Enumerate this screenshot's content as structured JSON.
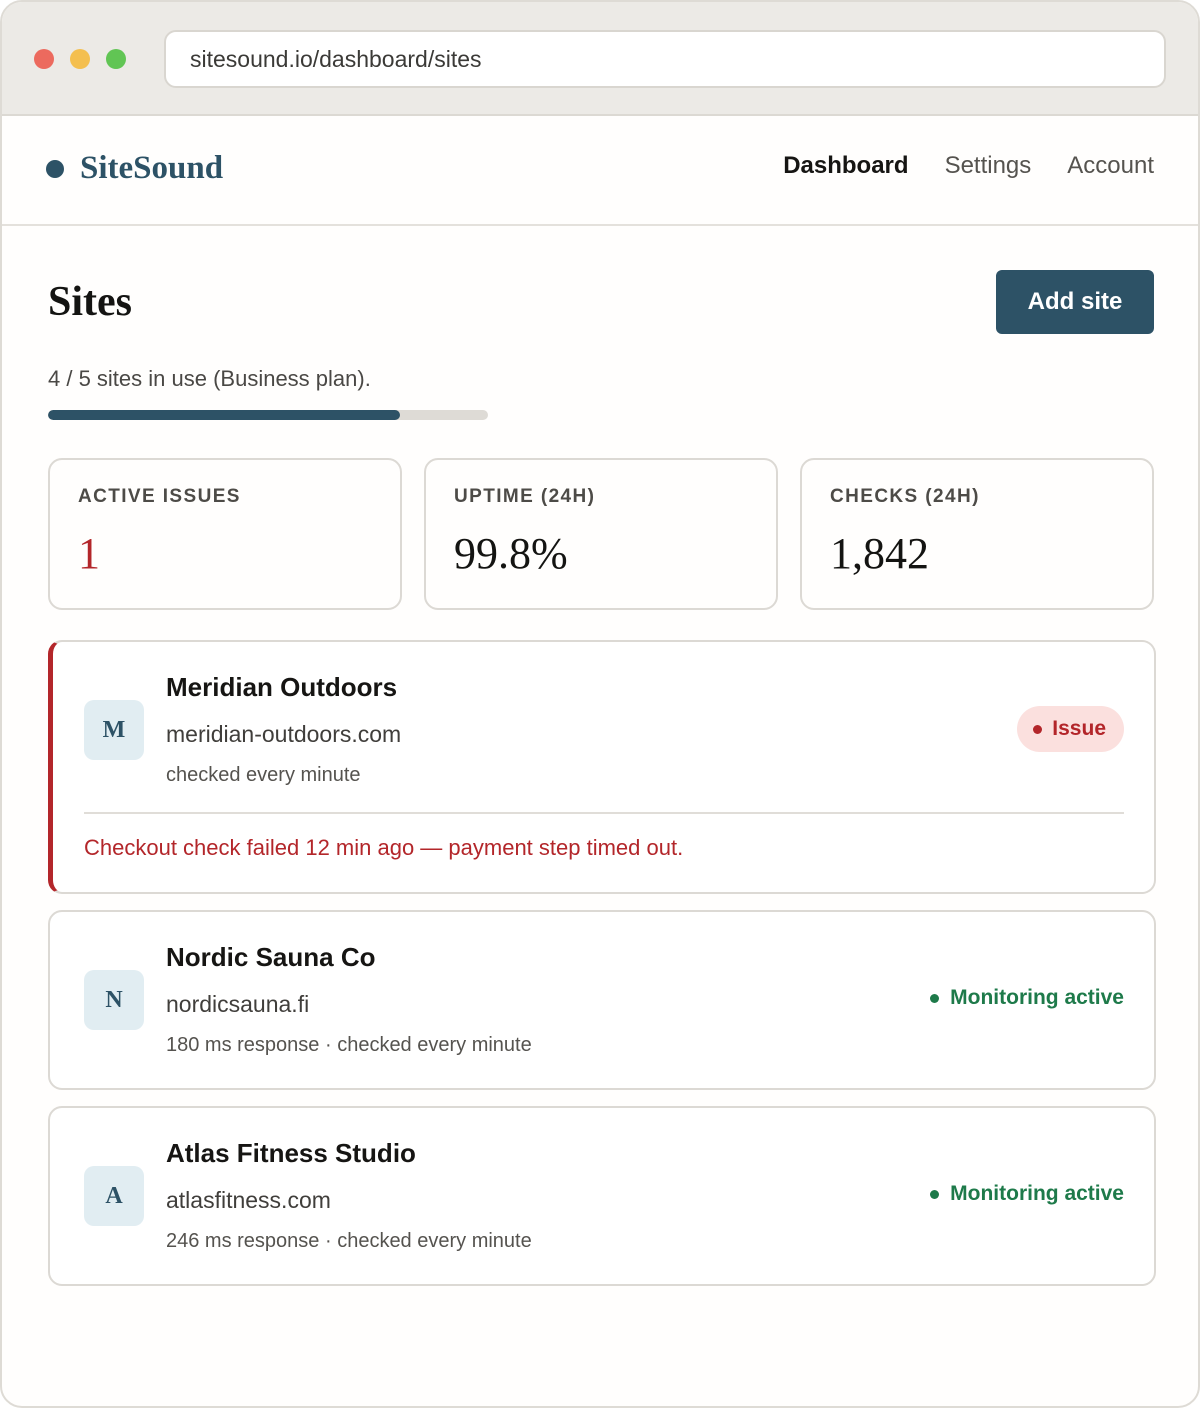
{
  "browser": {
    "url": "sitesound.io/dashboard/sites"
  },
  "brand": {
    "name": "SiteSound",
    "color": "#2d5266"
  },
  "nav": {
    "items": [
      {
        "label": "Dashboard",
        "active": true
      },
      {
        "label": "Settings",
        "active": false
      },
      {
        "label": "Account",
        "active": false
      }
    ]
  },
  "page": {
    "title": "Sites",
    "add_button": "Add site"
  },
  "usage": {
    "text": "4 / 5 sites in use (Business plan).",
    "used": 4,
    "limit": 5,
    "fraction": 0.8
  },
  "stats": [
    {
      "label": "ACTIVE ISSUES",
      "value": "1",
      "alert": true
    },
    {
      "label": "UPTIME (24H)",
      "value": "99.8%",
      "alert": false
    },
    {
      "label": "CHECKS (24H)",
      "value": "1,842",
      "alert": false
    }
  ],
  "sites": [
    {
      "initial": "M",
      "name": "Meridian Outdoors",
      "domain": "meridian-outdoors.com",
      "meta": "checked every minute",
      "status": "Issue",
      "issue_message": "Checkout check failed 12 min ago — payment step timed out."
    },
    {
      "initial": "N",
      "name": "Nordic Sauna Co",
      "domain": "nordicsauna.fi",
      "meta": "180 ms response · checked every minute",
      "status": "Monitoring active"
    },
    {
      "initial": "A",
      "name": "Atlas Fitness Studio",
      "domain": "atlasfitness.com",
      "meta": "246 ms response · checked every minute",
      "status": "Monitoring active"
    }
  ],
  "colors": {
    "accent": "#2d5266",
    "issue": "#b3262a",
    "ok": "#1e7a4a"
  }
}
